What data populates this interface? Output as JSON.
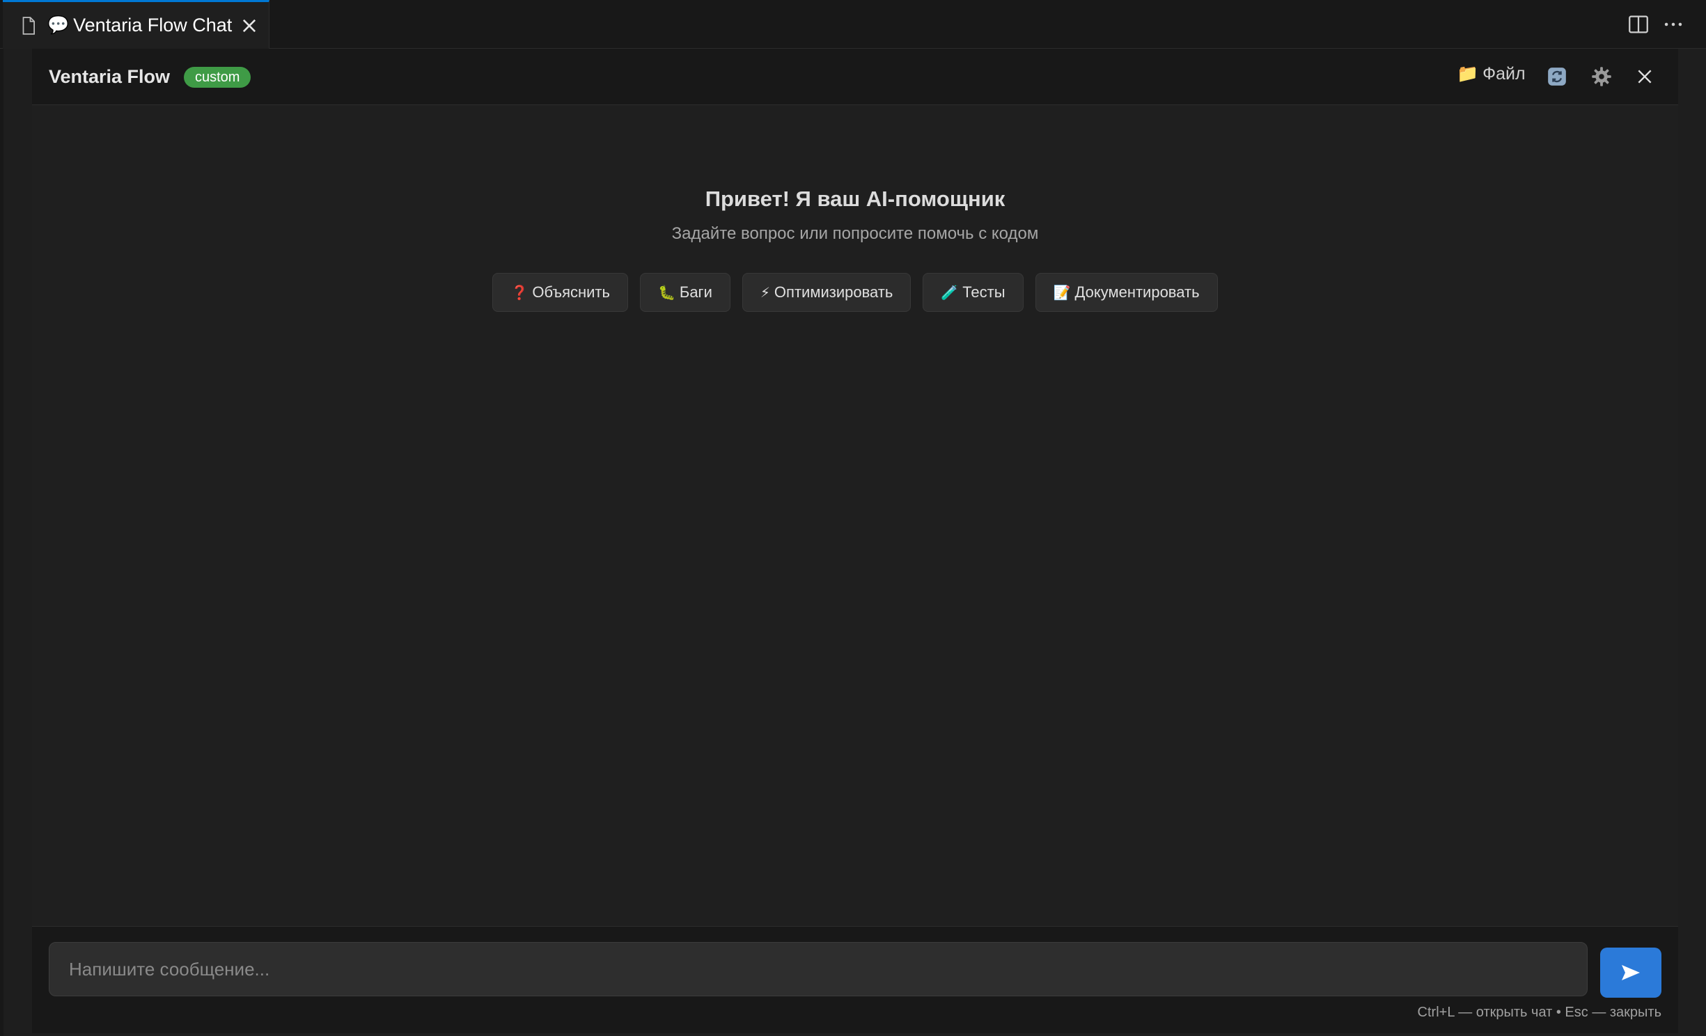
{
  "tab": {
    "emoji": "💬",
    "title": "Ventaria Flow Chat"
  },
  "header": {
    "brand": "Ventaria Flow",
    "badge": "custom",
    "file_emoji": "📁",
    "file_label": "Файл"
  },
  "welcome": {
    "title": "Привет! Я ваш AI-помощник",
    "subtitle": "Задайте вопрос или попросите помочь с кодом"
  },
  "quick_actions": [
    {
      "emoji": "❓",
      "label": "Объяснить"
    },
    {
      "emoji": "🐛",
      "label": "Баги"
    },
    {
      "emoji": "⚡",
      "label": "Оптимизировать"
    },
    {
      "emoji": "🧪",
      "label": "Тесты"
    },
    {
      "emoji": "📝",
      "label": "Документировать"
    }
  ],
  "input": {
    "placeholder": "Напишите сообщение...",
    "value": ""
  },
  "hint": "Ctrl+L — открыть чат • Esc — закрыть",
  "colors": {
    "accent": "#2b7ad9",
    "badge": "#3f9b46",
    "tab_indicator": "#0078d4"
  }
}
